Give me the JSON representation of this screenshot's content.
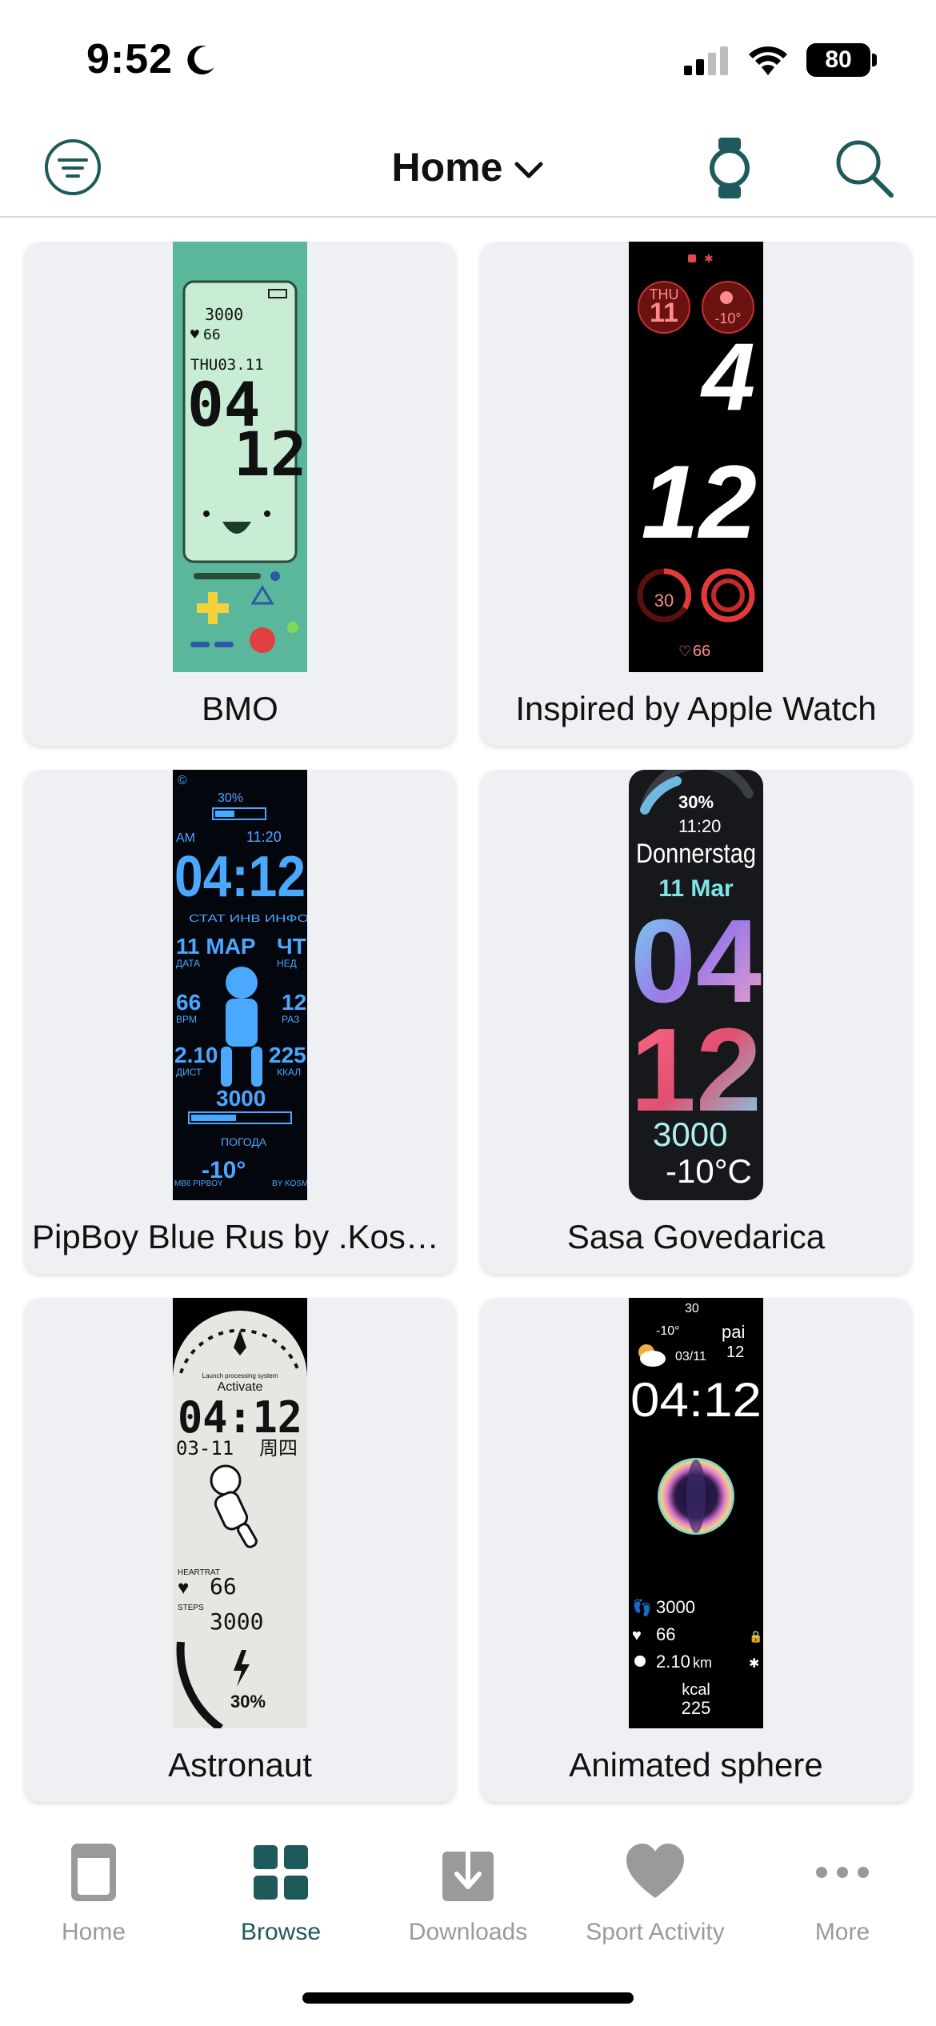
{
  "status_bar": {
    "time": "9:52",
    "battery": "80",
    "icons": [
      "moon-icon",
      "signal-icon",
      "wifi-icon",
      "battery-icon"
    ]
  },
  "header": {
    "title": "Home",
    "icons": [
      "filter-icon",
      "chevron-down-icon",
      "watch-icon",
      "search-icon"
    ],
    "accent_color": "#1f5a5a"
  },
  "cards": [
    {
      "name": "BMO",
      "face": {
        "steps": "3000",
        "heart": "66",
        "date": "THU03.11",
        "hour": "04",
        "minute": "12"
      }
    },
    {
      "name": "Inspired by Apple Watch",
      "face": {
        "day": "THU",
        "date": "11",
        "temp": "-10°",
        "hour": "4",
        "minute": "12",
        "battery": "30",
        "heart": "66"
      }
    },
    {
      "name": "PipBoy Blue Rus by .Kosmix",
      "face": {
        "battery": "30%",
        "ampm": "AM",
        "alarm": "11:20",
        "time": "04:12",
        "tabs": "СТАТ ИНВ ИНФО",
        "date": "11 МАР",
        "dow": "ЧТ",
        "date_label": "ДАТА",
        "week_label": "НЕД",
        "bpm": "66",
        "bpm_label": "BPM",
        "level": "12",
        "level_label": "РАЗ",
        "dist": "2.10",
        "dist_label": "ДИСТ",
        "kcal": "225",
        "kcal_label": "ККАЛ",
        "steps": "3000",
        "weather_label": "ПОГОДА",
        "temp": "-10°",
        "footer_left": "MB6 PIPBOY",
        "footer_right": "BY KOSMIX"
      }
    },
    {
      "name": "Sasa Govedarica",
      "face": {
        "battery": "30%",
        "alarm": "11:20",
        "weekday": "Donnerstag",
        "date": "11 Mar",
        "hour": "04",
        "minute": "12",
        "steps": "3000",
        "temp": "-10°C"
      }
    },
    {
      "name": "Astronaut",
      "face": {
        "system": "Launch processing system",
        "activate": "Activate",
        "time": "04:12",
        "date": "03-11",
        "dow": "周四",
        "heart_label": "HEARTRAT",
        "heart": "66",
        "steps_label": "STEPS",
        "steps": "3000",
        "battery": "30%"
      }
    },
    {
      "name": "Animated sphere",
      "face": {
        "battery": "30",
        "temp": "-10°",
        "date": "03/11",
        "pai_label": "pai",
        "pai": "12",
        "time": "04:12",
        "steps": "3000",
        "heart": "66",
        "dist": "2.10",
        "dist_unit": "km",
        "kcal_label": "kcal",
        "kcal": "225"
      }
    }
  ],
  "tabbar": {
    "tabs": [
      {
        "label": "Home",
        "icon": "watchface-icon",
        "active": false
      },
      {
        "label": "Browse",
        "icon": "grid-icon",
        "active": true
      },
      {
        "label": "Downloads",
        "icon": "download-icon",
        "active": false
      },
      {
        "label": "Sport Activity",
        "icon": "heart-icon",
        "active": false
      },
      {
        "label": "More",
        "icon": "ellipsis-icon",
        "active": false
      }
    ]
  }
}
